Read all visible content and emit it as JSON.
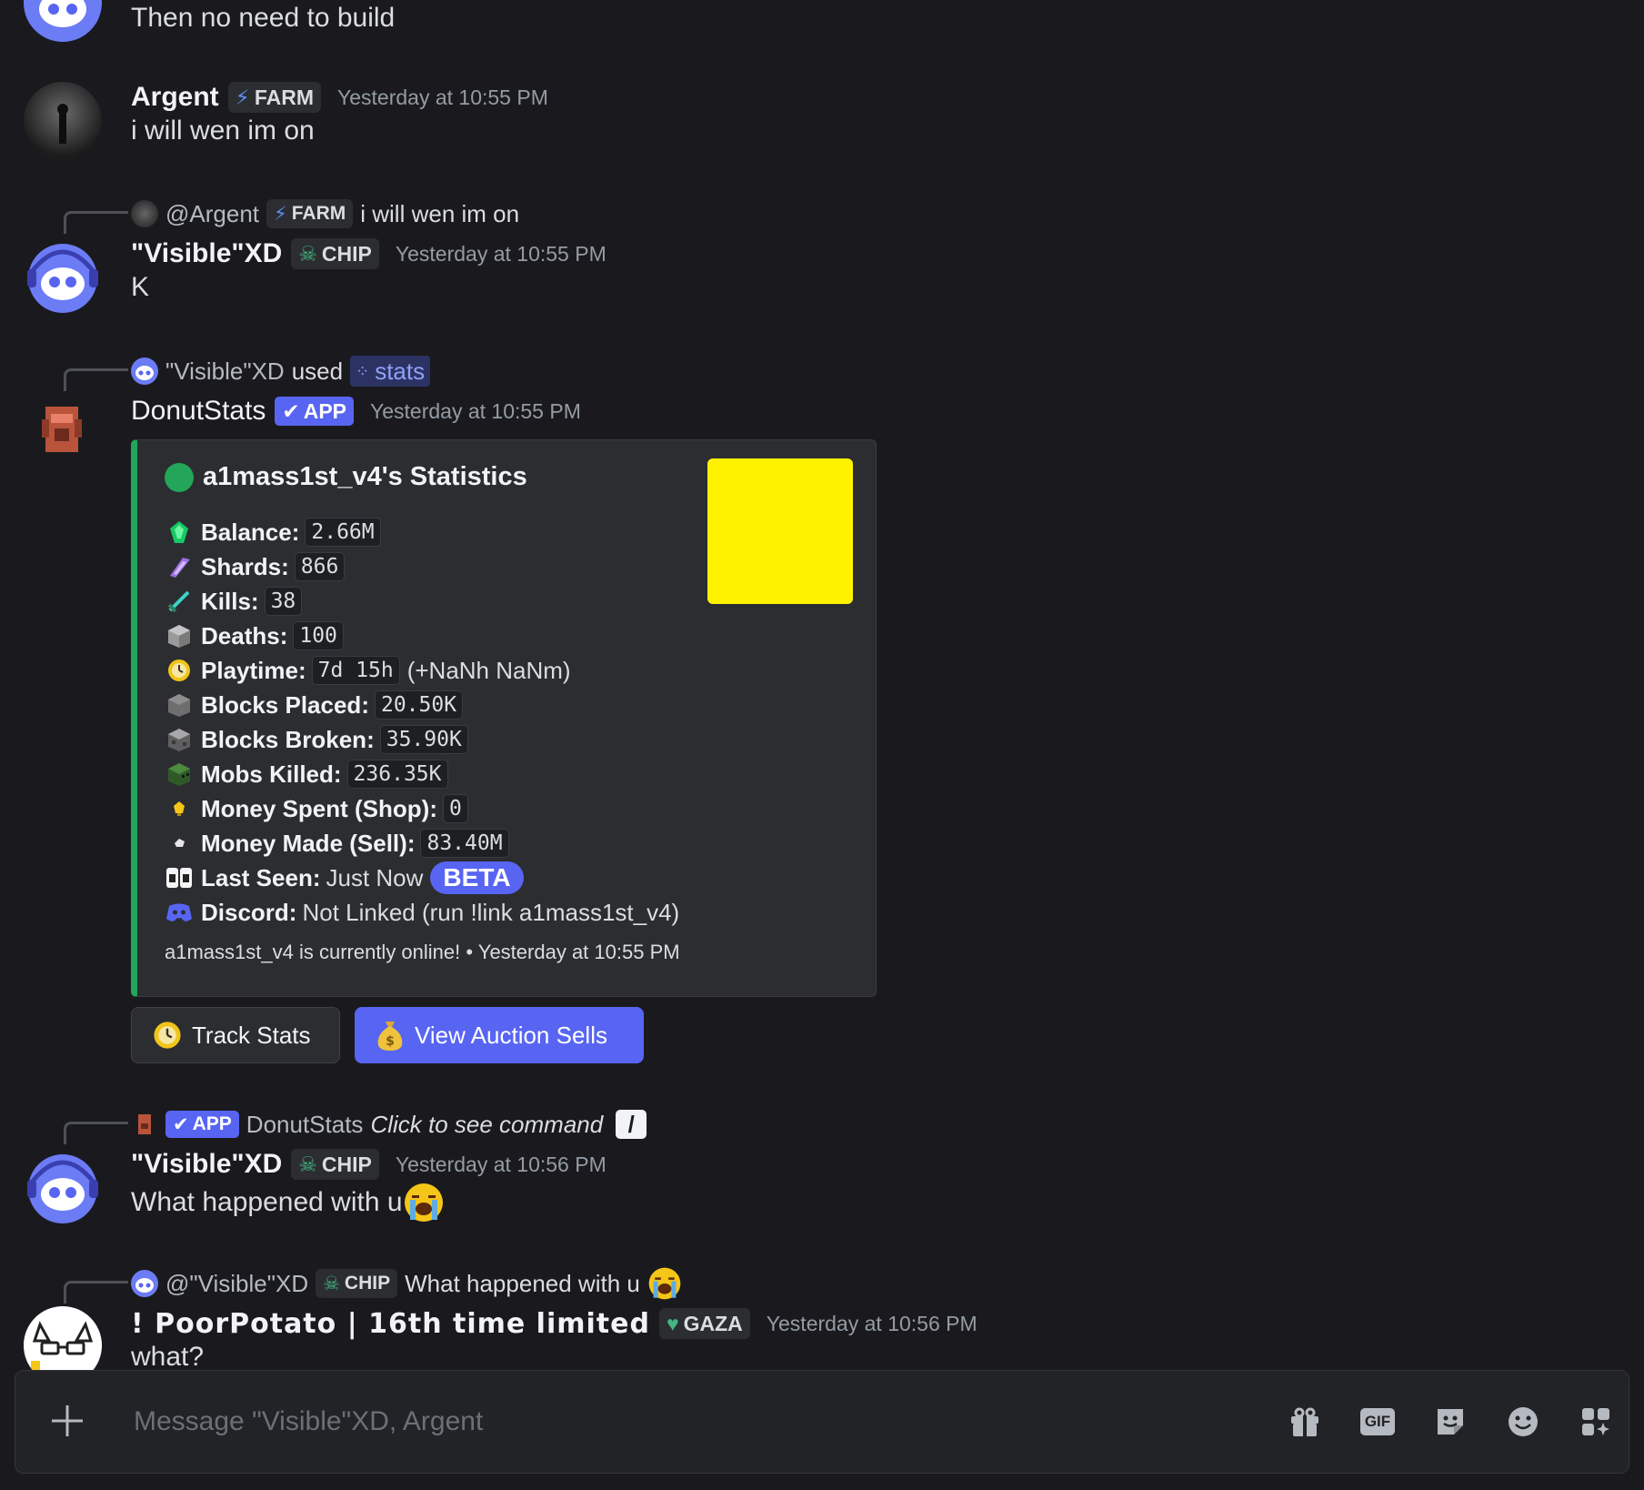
{
  "messages": {
    "m0": {
      "text": "Then no need to build"
    },
    "m1": {
      "author": "Argent",
      "tag": "FARM",
      "timestamp": "Yesterday at 10:55 PM",
      "text": "i will wen im on"
    },
    "m2": {
      "reply": {
        "mention": "@Argent",
        "tag": "FARM",
        "text": "i will wen im on"
      },
      "author": "\"Visible\"XD",
      "tag": "CHIP",
      "timestamp": "Yesterday at 10:55 PM",
      "text": "K"
    },
    "m3": {
      "interaction": {
        "user": "\"Visible\"XD",
        "used": "used",
        "command": "stats"
      },
      "author": "DonutStats",
      "app_badge": "APP",
      "timestamp": "Yesterday at 10:55 PM",
      "embed": {
        "title": "a1mass1st_v4's Statistics",
        "rows": [
          {
            "label": "Balance:",
            "value": "2.66M",
            "icon": "emerald-icon"
          },
          {
            "label": "Shards:",
            "value": "866",
            "icon": "amethyst-shard-icon"
          },
          {
            "label": "Kills:",
            "value": "38",
            "icon": "sword-icon"
          },
          {
            "label": "Deaths:",
            "value": "100",
            "icon": "stone-block-icon"
          },
          {
            "label": "Playtime:",
            "value": "7d 15h",
            "extra": "(+NaNh NaNm)",
            "icon": "clock-icon"
          },
          {
            "label": "Blocks Placed:",
            "value": "20.50K",
            "icon": "block-icon"
          },
          {
            "label": "Blocks Broken:",
            "value": "35.90K",
            "icon": "cobblestone-icon"
          },
          {
            "label": "Mobs Killed:",
            "value": "236.35K",
            "icon": "zombie-head-icon"
          },
          {
            "label": "Money Spent (Shop):",
            "value": "0",
            "icon": "gold-nugget-icon"
          },
          {
            "label": "Money Made (Sell):",
            "value": "83.40M",
            "icon": "iron-nugget-icon"
          }
        ],
        "last_seen": {
          "label": "Last Seen:",
          "value": "Just Now",
          "badge": "BETA"
        },
        "discord": {
          "label": "Discord:",
          "value": "Not Linked (run !link a1mass1st_v4)"
        },
        "footer": "a1mass1st_v4 is currently online! • Yesterday at 10:55 PM"
      },
      "buttons": {
        "track": "Track Stats",
        "auction": "View Auction Sells"
      }
    },
    "m4": {
      "reply": {
        "app_badge": "APP",
        "bot": "DonutStats",
        "text": "Click to see command"
      },
      "author": "\"Visible\"XD",
      "tag": "CHIP",
      "timestamp": "Yesterday at 10:56 PM",
      "text": "What happened with u"
    },
    "m5": {
      "reply": {
        "mention": "@\"Visible\"XD",
        "tag": "CHIP",
        "text": "What happened with u"
      },
      "author": "! PoorPotato | 16th time limited",
      "tag": "GAZA",
      "timestamp": "Yesterday at 10:56 PM",
      "text": "what?"
    }
  },
  "composer": {
    "placeholder": "Message \"Visible\"XD, Argent",
    "gif_label": "GIF"
  },
  "colors": {
    "background": "#1a1a1e",
    "blurple": "#5865f2",
    "embed_accent": "#23a55a",
    "thumbnail": "#fff200"
  }
}
